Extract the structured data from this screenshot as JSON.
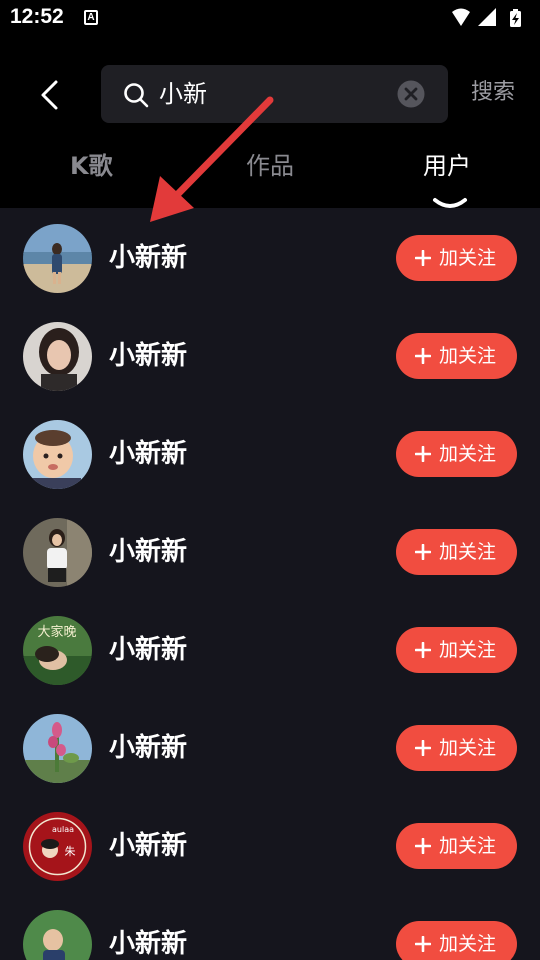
{
  "status_bar": {
    "time": "12:52",
    "app_icon_letter": "A",
    "icons": [
      "wifi-icon",
      "cell-signal-icon",
      "battery-icon"
    ]
  },
  "header": {
    "back_icon": "chevron-left-icon",
    "search": {
      "icon": "search-icon",
      "value": "小新",
      "clear_icon": "clear-icon"
    },
    "search_button_label": "搜索"
  },
  "tabs": [
    {
      "label": "K歌",
      "active": false
    },
    {
      "label": "作品",
      "active": false
    },
    {
      "label": "用户",
      "active": true
    }
  ],
  "users": [
    {
      "name": "小新新",
      "follow_label": "加关注"
    },
    {
      "name": "小新新",
      "follow_label": "加关注"
    },
    {
      "name": "小新新",
      "follow_label": "加关注"
    },
    {
      "name": "小新新",
      "follow_label": "加关注"
    },
    {
      "name": "小新新",
      "follow_label": "加关注"
    },
    {
      "name": "小新新",
      "follow_label": "加关注"
    },
    {
      "name": "小新新",
      "follow_label": "加关注"
    },
    {
      "name": "小新新",
      "follow_label": "加关注"
    }
  ],
  "avatar_texts": {
    "avatar5": "大家晚",
    "avatar7_top": "aulaa",
    "avatar7_center": "朱"
  },
  "colors": {
    "background": "#15151d",
    "header_background": "#000000",
    "follow_button": "#f14d40",
    "annotation_arrow": "#e23a3a"
  }
}
